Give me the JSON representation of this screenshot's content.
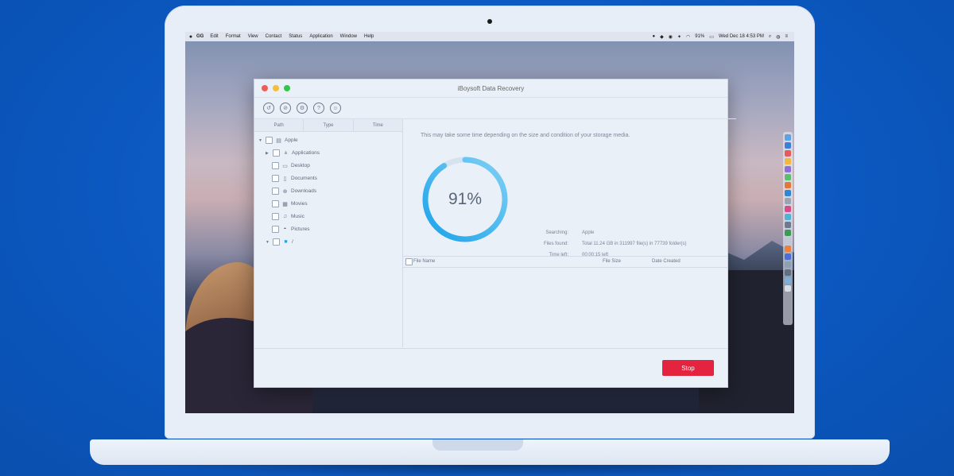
{
  "menubar": {
    "apple": "",
    "app_name": "GG",
    "items": [
      "Edit",
      "Format",
      "View",
      "Contact",
      "Status",
      "Application",
      "Window",
      "Help"
    ],
    "battery": "91%",
    "clock": "Wed Dec 18 4:53 PM"
  },
  "window": {
    "title": "iBoysoft Data Recovery",
    "toolbar_icons": [
      "recover-icon",
      "scan-icon",
      "settings-icon",
      "help-icon",
      "feedback-icon"
    ]
  },
  "tree": {
    "columns": [
      "Path",
      "Type",
      "Time"
    ],
    "items": [
      {
        "label": "Apple",
        "icon": "drive-icon"
      },
      {
        "label": "Applications",
        "icon": "apps-icon"
      },
      {
        "label": "Desktop",
        "icon": "desktop-icon"
      },
      {
        "label": "Documents",
        "icon": "documents-icon"
      },
      {
        "label": "Downloads",
        "icon": "downloads-icon"
      },
      {
        "label": "Movies",
        "icon": "movies-icon"
      },
      {
        "label": "Music",
        "icon": "music-icon"
      },
      {
        "label": "Pictures",
        "icon": "pictures-icon"
      },
      {
        "label": "/",
        "icon": "folder-icon"
      }
    ]
  },
  "scan": {
    "hint": "This may take some time depending on the size and condition of your storage media.",
    "progress_label": "91%",
    "progress": 0.91,
    "searching_key": "Searching:",
    "searching_value": "Apple",
    "files_found_key": "Files found:",
    "files_found_value": "Total 11.24 GB in 311997 file(s) in 77739 folder(s)",
    "time_left_key": "Time left:",
    "time_left_value": "00:00:15 left"
  },
  "file_list": {
    "col_name": "File Name",
    "col_size": "File Size",
    "col_date": "Date Created"
  },
  "actions": {
    "stop": "Stop"
  },
  "colors": {
    "background": "#0b58c0",
    "accent_ring": "#1aa3ea",
    "stop_button": "#e4243f",
    "folder": "#2fa3e6"
  }
}
